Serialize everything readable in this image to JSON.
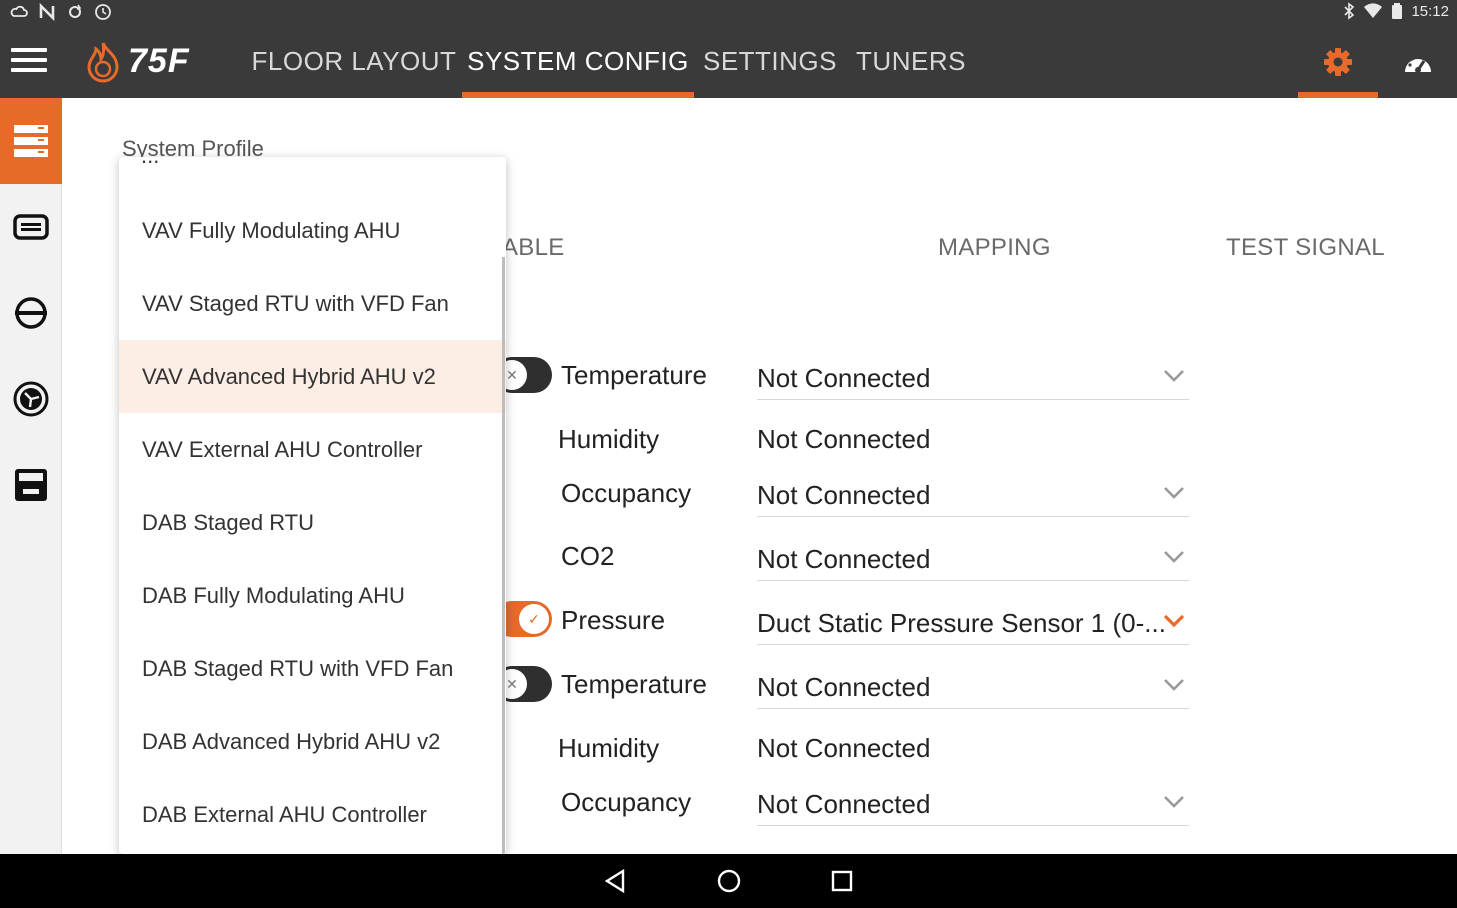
{
  "status_bar": {
    "time": "15:12",
    "left_icons": [
      "cloud-icon",
      "n-icon",
      "sync-icon",
      "clock-icon"
    ],
    "right_icons": [
      "bluetooth-icon",
      "wifi-icon",
      "battery-icon"
    ]
  },
  "app_bar": {
    "logo_text": "75F",
    "tabs": [
      {
        "label": "FLOOR LAYOUT",
        "active": false
      },
      {
        "label": "SYSTEM CONFIG",
        "active": true
      },
      {
        "label": "SETTINGS",
        "active": false
      },
      {
        "label": "TUNERS",
        "active": false
      }
    ],
    "icons": [
      "settings-gear-icon",
      "dashboard-gauge-icon"
    ],
    "active_icon": "settings-gear-icon"
  },
  "side_rail": {
    "items": [
      "system-profile-icon",
      "ahu-icon",
      "oao-icon",
      "fan-icon",
      "rtu-icon"
    ],
    "active_item": "system-profile-icon"
  },
  "content": {
    "system_profile_label": "System Profile",
    "column_headers": {
      "enable": "ABLE",
      "mapping": "MAPPING",
      "test_signal": "TEST SIGNAL"
    },
    "rows": [
      {
        "label": "Temperature",
        "value": "Not Connected",
        "toggle": "off",
        "select": true
      },
      {
        "label": "Humidity",
        "value": "Not Connected",
        "toggle": null,
        "select": false
      },
      {
        "label": "Occupancy",
        "value": "Not Connected",
        "toggle": null,
        "select": true
      },
      {
        "label": "CO2",
        "value": "Not Connected",
        "toggle": null,
        "select": true
      },
      {
        "label": "Pressure",
        "value": "Duct Static Pressure Sensor 1 (0-...",
        "toggle": "on",
        "select": true
      },
      {
        "label": "Temperature",
        "value": "Not Connected",
        "toggle": "off",
        "select": true
      },
      {
        "label": "Humidity",
        "value": "Not Connected",
        "toggle": null,
        "select": false
      },
      {
        "label": "Occupancy",
        "value": "Not Connected",
        "toggle": null,
        "select": true
      }
    ]
  },
  "dropdown": {
    "partial_top_text": "...",
    "options": [
      "VAV Fully Modulating AHU",
      "VAV Staged RTU with VFD Fan",
      "VAV Advanced Hybrid AHU v2",
      "VAV External AHU Controller",
      "DAB Staged RTU",
      "DAB Fully Modulating AHU",
      "DAB Staged RTU with VFD Fan",
      "DAB Advanced Hybrid AHU v2",
      "DAB External AHU Controller"
    ],
    "selected": "VAV Advanced Hybrid AHU v2"
  },
  "nav_bar": {
    "buttons": [
      "back-icon",
      "home-icon",
      "recents-icon"
    ]
  },
  "colors": {
    "accent": "#e76a2b",
    "app_bar": "#3a3a3a",
    "selected_option_bg": "#fdeee5"
  }
}
